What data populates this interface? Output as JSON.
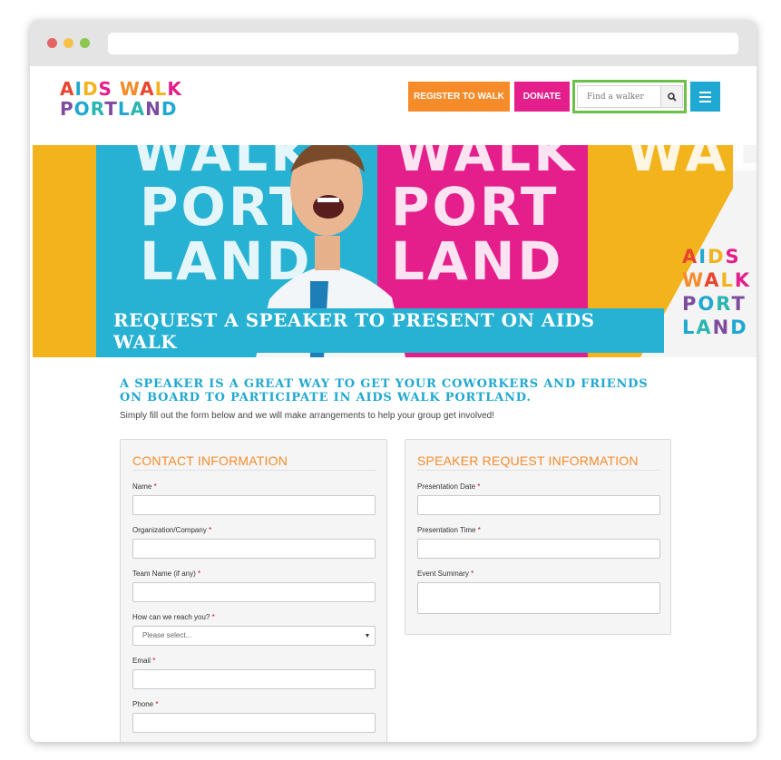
{
  "header": {
    "logo": {
      "line1": "AIDS WALK",
      "line2": "PORTLAND"
    },
    "register_label": "REGISTER TO WALK",
    "donate_label": "DONATE",
    "search": {
      "placeholder": "Find a walker"
    }
  },
  "hero": {
    "banner_title": "REQUEST A SPEAKER TO PRESENT ON AIDS WALK",
    "panel_words": [
      "WALK",
      "PORT",
      "LAND"
    ],
    "hero_logo": [
      "AIDS",
      "WALK",
      "PORT",
      "LAND"
    ]
  },
  "intro": {
    "headline": "A SPEAKER IS A GREAT WAY TO GET YOUR COWORKERS AND FRIENDS ON BOARD TO PARTICIPATE IN AIDS WALK PORTLAND.",
    "subtext": "Simply fill out the form below and we will make arrangements to help your group get involved!"
  },
  "contact_form": {
    "title": "CONTACT INFORMATION",
    "fields": {
      "name": "Name",
      "organization": "Organization/Company",
      "team_name": "Team Name (if any)",
      "reach": "How can we reach you?",
      "reach_selected": "Please select...",
      "email": "Email",
      "phone": "Phone"
    }
  },
  "speaker_form": {
    "title": "SPEAKER REQUEST INFORMATION",
    "fields": {
      "date": "Presentation Date",
      "time": "Presentation Time",
      "summary": "Event Summary"
    }
  },
  "required_marker": "*",
  "colors": {
    "orange": "#f68b2a",
    "pink": "#e41e8a",
    "blue": "#1fa8d1",
    "green": "#6cc04a",
    "yellow": "#f2b31c"
  }
}
